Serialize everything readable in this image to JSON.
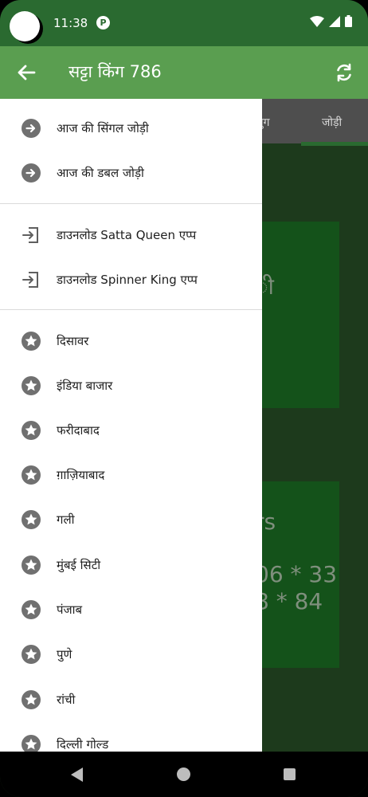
{
  "status_bar": {
    "time": "11:38",
    "app_icon": "P"
  },
  "app_bar": {
    "title": "सट्टा किंग 786"
  },
  "background": {
    "tabs": [
      "लयुग",
      "जोड़ी"
    ],
    "card1_text": "ी",
    "card2_text": "rs",
    "card2_line1": "06 * 33",
    "card2_line2": "8 * 84"
  },
  "drawer": {
    "section1": [
      {
        "label": "आज की सिंगल जोड़ी",
        "icon": "arrow-circle-icon"
      },
      {
        "label": "आज की डबल जोड़ी",
        "icon": "arrow-circle-icon"
      }
    ],
    "section2": [
      {
        "label": "डाउनलोड Satta Queen एप्प",
        "icon": "login-icon"
      },
      {
        "label": "डाउनलोड Spinner King एप्प",
        "icon": "login-icon"
      }
    ],
    "section3": [
      {
        "label": "दिसावर",
        "icon": "star-circle-icon"
      },
      {
        "label": "इंडिया बाजार",
        "icon": "star-circle-icon"
      },
      {
        "label": "फरीदाबाद",
        "icon": "star-circle-icon"
      },
      {
        "label": "ग़ाज़ियाबाद",
        "icon": "star-circle-icon"
      },
      {
        "label": "गली",
        "icon": "star-circle-icon"
      },
      {
        "label": "मुंबई सिटी",
        "icon": "star-circle-icon"
      },
      {
        "label": "पंजाब",
        "icon": "star-circle-icon"
      },
      {
        "label": "पुणे",
        "icon": "star-circle-icon"
      },
      {
        "label": "रांची",
        "icon": "star-circle-icon"
      },
      {
        "label": "दिल्ली गोल्ड",
        "icon": "star-circle-icon"
      }
    ]
  },
  "colors": {
    "status_bar": "#2a6a30",
    "app_bar": "#5a9e50",
    "drawer_bg": "#ffffff",
    "icon_gray": "#707070"
  }
}
